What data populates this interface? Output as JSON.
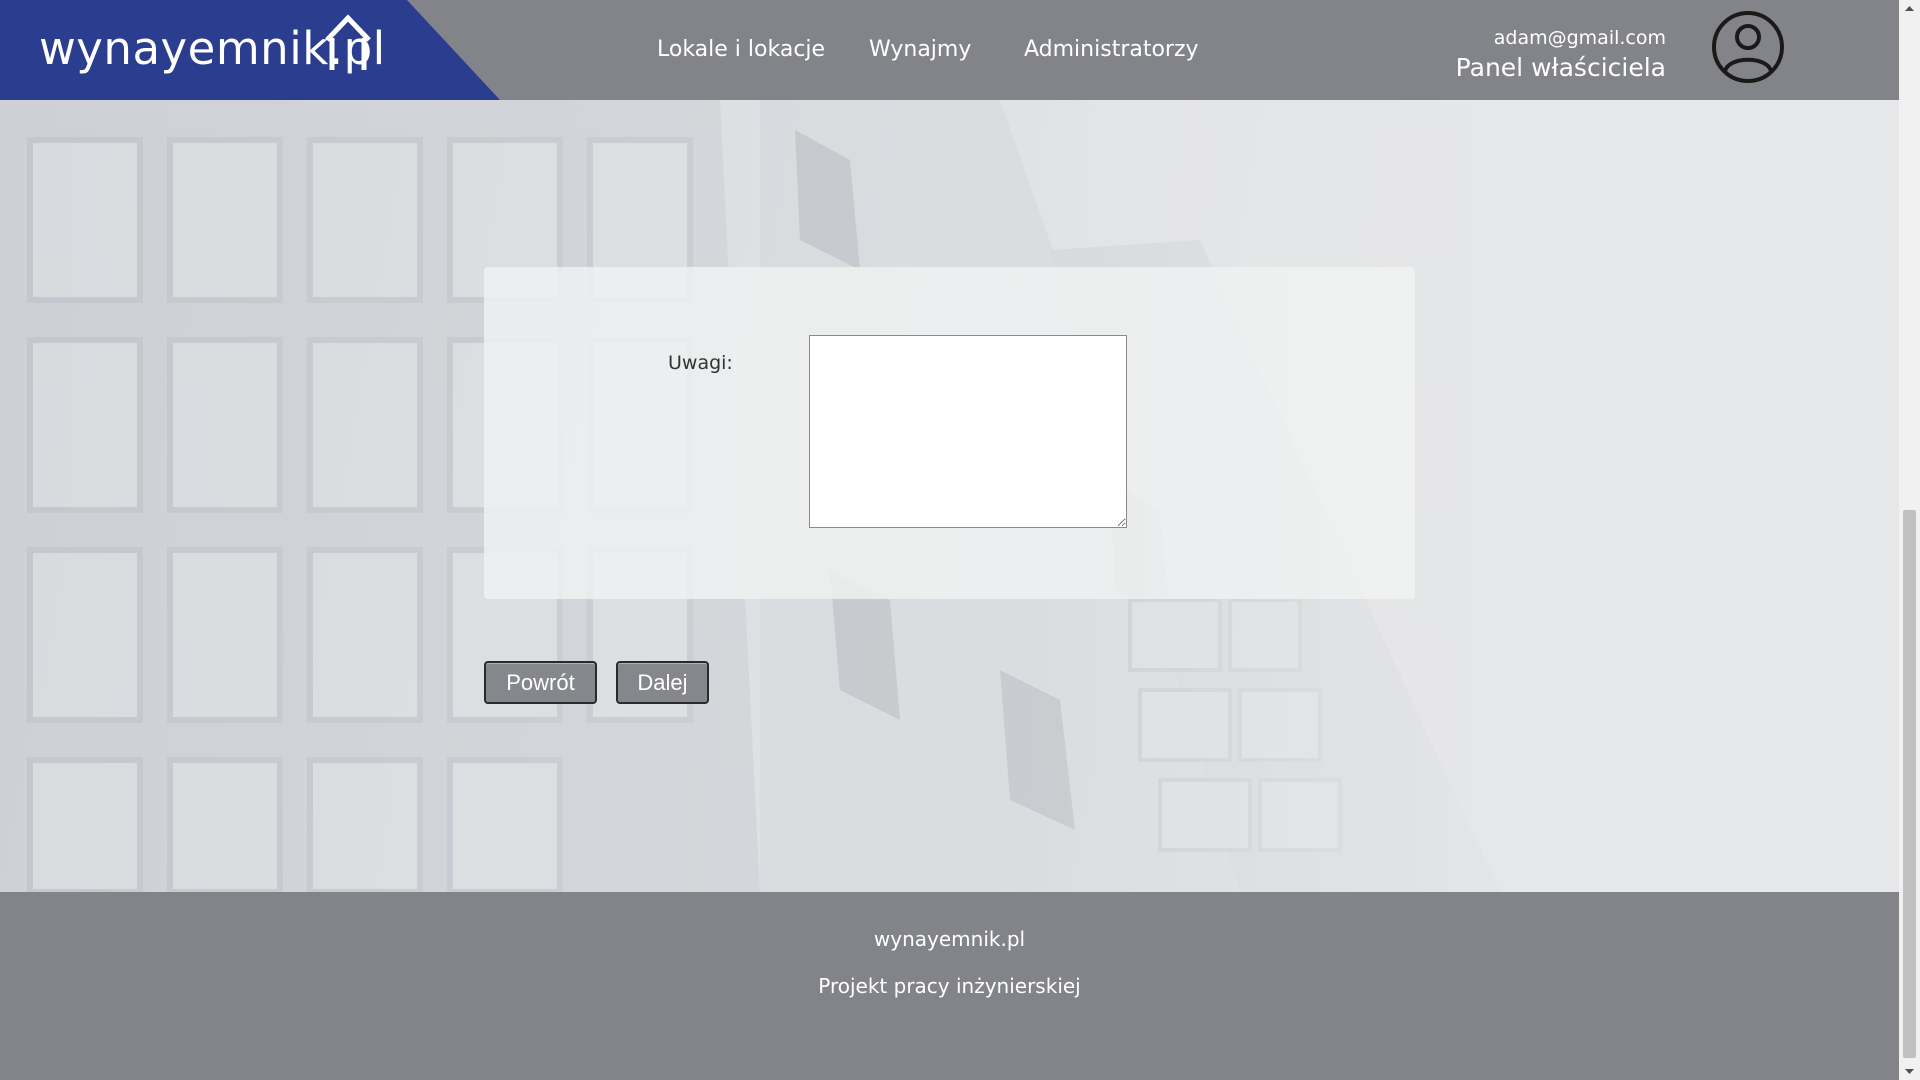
{
  "header": {
    "logo_text": "wynayemnik.pl",
    "nav": [
      {
        "label": "Lokale i lokacje"
      },
      {
        "label": "Wynajmy"
      },
      {
        "label": "Administratorzy"
      }
    ],
    "user_email": "adam@gmail.com",
    "panel_label": "Panel właściciela",
    "avatar_icon": "user-circle-icon"
  },
  "form": {
    "notes_label": "Uwagi:",
    "notes_value": "",
    "back_label": "Powrót",
    "next_label": "Dalej"
  },
  "footer": {
    "site_name": "wynayemnik.pl",
    "subtitle": "Projekt pracy inżynierskiej"
  },
  "colors": {
    "header_bg": "#838489",
    "logo_bg": "#2b3d8f",
    "button_bg": "#85878c",
    "footer_bg": "#838489"
  }
}
